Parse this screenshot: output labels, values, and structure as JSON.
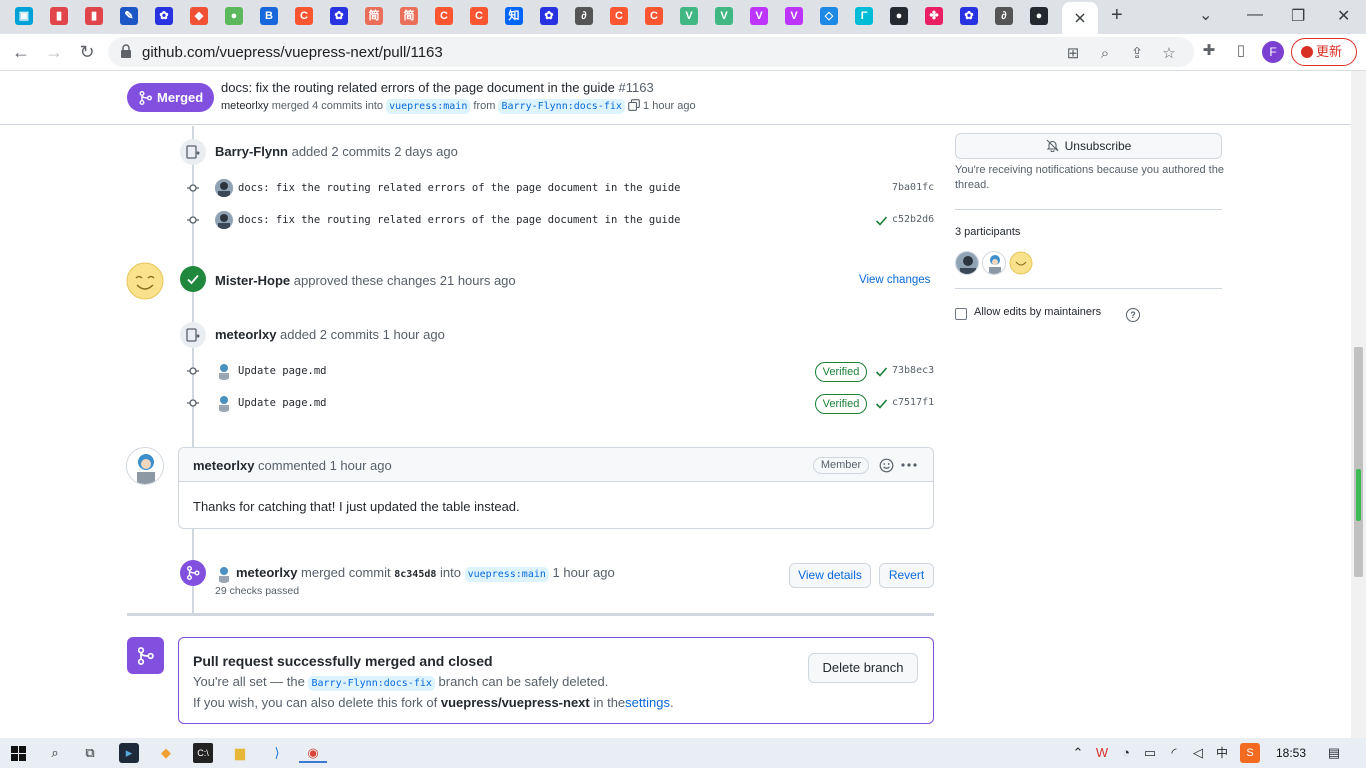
{
  "browser": {
    "url": "github.com/vuepress/vuepress-next/pull/1163",
    "update_label": "更新",
    "profile_initial": "F",
    "tab_icons": [
      {
        "name": "bilibili-icon",
        "color": "#00a1d6",
        "glyph": "▣"
      },
      {
        "name": "app-icon",
        "color": "#e0454b",
        "glyph": "▮"
      },
      {
        "name": "app-icon",
        "color": "#e0454b",
        "glyph": "▮"
      },
      {
        "name": "pen-icon",
        "color": "#1d56c5",
        "glyph": "✎"
      },
      {
        "name": "baidu-icon",
        "color": "#2932e1",
        "glyph": "✿"
      },
      {
        "name": "git-icon",
        "color": "#f05133",
        "glyph": "◆"
      },
      {
        "name": "app-icon",
        "color": "#5cb85c",
        "glyph": "●"
      },
      {
        "name": "bitbucket-icon",
        "color": "#1868db",
        "glyph": "B"
      },
      {
        "name": "csdn-icon",
        "color": "#fc5531",
        "glyph": "C"
      },
      {
        "name": "baidu-icon",
        "color": "#2932e1",
        "glyph": "✿"
      },
      {
        "name": "jianshu-icon",
        "color": "#ea6f5a",
        "glyph": "简"
      },
      {
        "name": "jianshu-icon",
        "color": "#ea6f5a",
        "glyph": "简"
      },
      {
        "name": "csdn-icon",
        "color": "#fc5531",
        "glyph": "C"
      },
      {
        "name": "csdn-icon",
        "color": "#fc5531",
        "glyph": "C"
      },
      {
        "name": "zhihu-icon",
        "color": "#0066ff",
        "glyph": "知"
      },
      {
        "name": "baidu-icon",
        "color": "#2932e1",
        "glyph": "✿"
      },
      {
        "name": "app-icon",
        "color": "#555555",
        "glyph": "∂"
      },
      {
        "name": "csdn-icon",
        "color": "#fc5531",
        "glyph": "C"
      },
      {
        "name": "csdn-icon",
        "color": "#fc5531",
        "glyph": "C"
      },
      {
        "name": "vue-icon",
        "color": "#41b883",
        "glyph": "V"
      },
      {
        "name": "vue-icon",
        "color": "#41b883",
        "glyph": "V"
      },
      {
        "name": "vite-icon",
        "color": "#bd34fe",
        "glyph": "V"
      },
      {
        "name": "vite-icon",
        "color": "#bd34fe",
        "glyph": "V"
      },
      {
        "name": "app-icon",
        "color": "#1e88e5",
        "glyph": "◇"
      },
      {
        "name": "app-icon",
        "color": "#00bcd4",
        "glyph": "Γ"
      },
      {
        "name": "github-icon",
        "color": "#24292f",
        "glyph": "●"
      },
      {
        "name": "app-icon",
        "color": "#e91e63",
        "glyph": "✤"
      },
      {
        "name": "baidu-icon",
        "color": "#2932e1",
        "glyph": "✿"
      },
      {
        "name": "app-icon",
        "color": "#555555",
        "glyph": "∂"
      },
      {
        "name": "github-icon",
        "color": "#24292f",
        "glyph": "●"
      }
    ]
  },
  "header": {
    "state_label": "Merged",
    "title": "docs: fix the routing related errors of the page document in the guide",
    "number": "#1163",
    "author": "meteorlxy",
    "merged_text": "merged 4 commits into",
    "base_branch": "vuepress:main",
    "from_text": "from",
    "head_branch": "Barry-Flynn:docs-fix",
    "time": "1 hour ago"
  },
  "timeline": {
    "push1": {
      "actor": "Barry-Flynn",
      "text": "added 2 commits 2 days ago",
      "commits": [
        {
          "message": "docs: fix the routing related errors of the page document in the guide",
          "sha": "7ba01fc",
          "checked": false
        },
        {
          "message": "docs: fix the routing related errors of the page document in the guide",
          "sha": "c52b2d6",
          "checked": true
        }
      ]
    },
    "review": {
      "actor": "Mister-Hope",
      "text": "approved these changes 21 hours ago",
      "link": "View changes"
    },
    "push2": {
      "actor": "meteorlxy",
      "text": "added 2 commits 1 hour ago",
      "commits": [
        {
          "message": "Update page.md",
          "sha": "73b8ec3",
          "badge": "Verified"
        },
        {
          "message": "Update page.md",
          "sha": "c7517f1",
          "badge": "Verified"
        }
      ]
    },
    "comment": {
      "author": "meteorlxy",
      "meta": "commented 1 hour ago",
      "role": "Member",
      "body": "Thanks for catching that! I just updated the table instead."
    },
    "merge_event": {
      "actor": "meteorlxy",
      "text1": "merged commit",
      "sha": "8c345d8",
      "text2": "into",
      "branch": "vuepress:main",
      "time": "1 hour ago",
      "checks": "29 checks passed",
      "details_btn": "View details",
      "revert_btn": "Revert"
    }
  },
  "merge_box": {
    "title": "Pull request successfully merged and closed",
    "line1_pre": "You're all set — the",
    "branch": "Barry-Flynn:docs-fix",
    "line1_post": "branch can be safely deleted.",
    "line2_pre": "If you wish, you can also delete this fork of",
    "repo": "vuepress/vuepress-next",
    "line2_mid": "in the",
    "settings_link": "settings",
    "line2_end": ".",
    "delete_btn": "Delete branch"
  },
  "sidebar": {
    "unsubscribe": "Unsubscribe",
    "notification_note": "You're receiving notifications because you authored the thread.",
    "participants_label": "3 participants",
    "allow_edits": "Allow edits by maintainers"
  },
  "taskbar": {
    "time": "18:53",
    "ime": "中"
  }
}
